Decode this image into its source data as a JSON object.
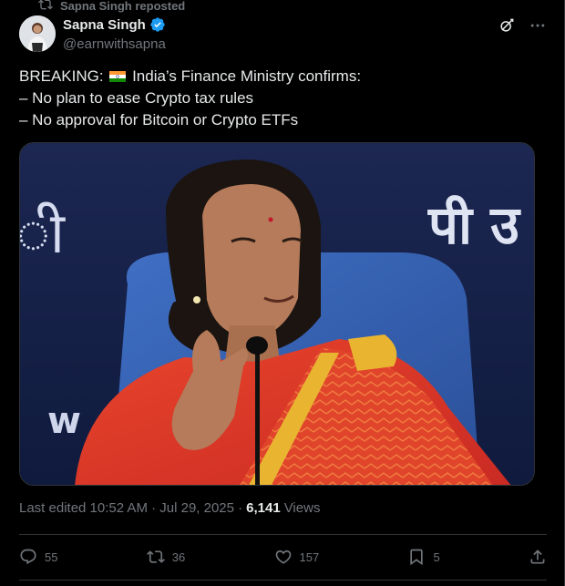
{
  "repost": {
    "text": "Sapna Singh reposted",
    "icon": "repost-icon"
  },
  "author": {
    "name": "Sapna Singh",
    "handle": "@earnwithsapna",
    "verified": true
  },
  "tweet": {
    "text_prefix": "BREAKING:",
    "text_line1": "India’s Finance Ministry confirms:",
    "text_line2": "– No plan to ease Crypto tax rules",
    "text_line3": "– No approval for Bitcoin or Crypto ETFs"
  },
  "media": {
    "background_text_left": "ी",
    "background_text_right": "पी उ",
    "background_text_bottom": "w"
  },
  "meta": {
    "edited": "Last edited 10:52 AM · Jul 29, 2025 ·",
    "views_count": "6,141",
    "views_label": "Views"
  },
  "actions": {
    "replies": "55",
    "reposts": "36",
    "likes": "157",
    "bookmarks": "5"
  },
  "colors": {
    "accent": "#1d9bf0",
    "muted": "#71767b",
    "text": "#e7e9ea",
    "bg": "#000000"
  }
}
